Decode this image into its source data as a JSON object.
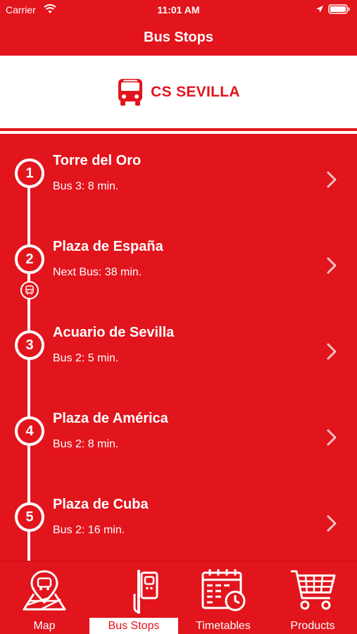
{
  "status_bar": {
    "carrier": "Carrier",
    "time": "11:01 AM"
  },
  "nav": {
    "title": "Bus Stops"
  },
  "brand": {
    "name": "CS SEVILLA"
  },
  "stops": [
    {
      "number": "1",
      "name": "Torre del Oro",
      "eta": "Bus 3: 8 min."
    },
    {
      "number": "2",
      "name": "Plaza de España",
      "eta": "Next Bus: 38 min."
    },
    {
      "number": "3",
      "name": "Acuario de Sevilla",
      "eta": "Bus 2: 5 min."
    },
    {
      "number": "4",
      "name": "Plaza de América",
      "eta": "Bus 2: 8 min."
    },
    {
      "number": "5",
      "name": "Plaza de Cuba",
      "eta": "Bus 2: 16 min."
    }
  ],
  "tabs": [
    {
      "label": "Map",
      "icon": "map-icon",
      "active": false
    },
    {
      "label": "Bus Stops",
      "icon": "bus-stop-icon",
      "active": true
    },
    {
      "label": "Timetables",
      "icon": "timetables-icon",
      "active": false
    },
    {
      "label": "Products",
      "icon": "products-cart-icon",
      "active": false
    }
  ],
  "colors": {
    "brand_red": "#E2141C",
    "white": "#FFFFFF"
  }
}
